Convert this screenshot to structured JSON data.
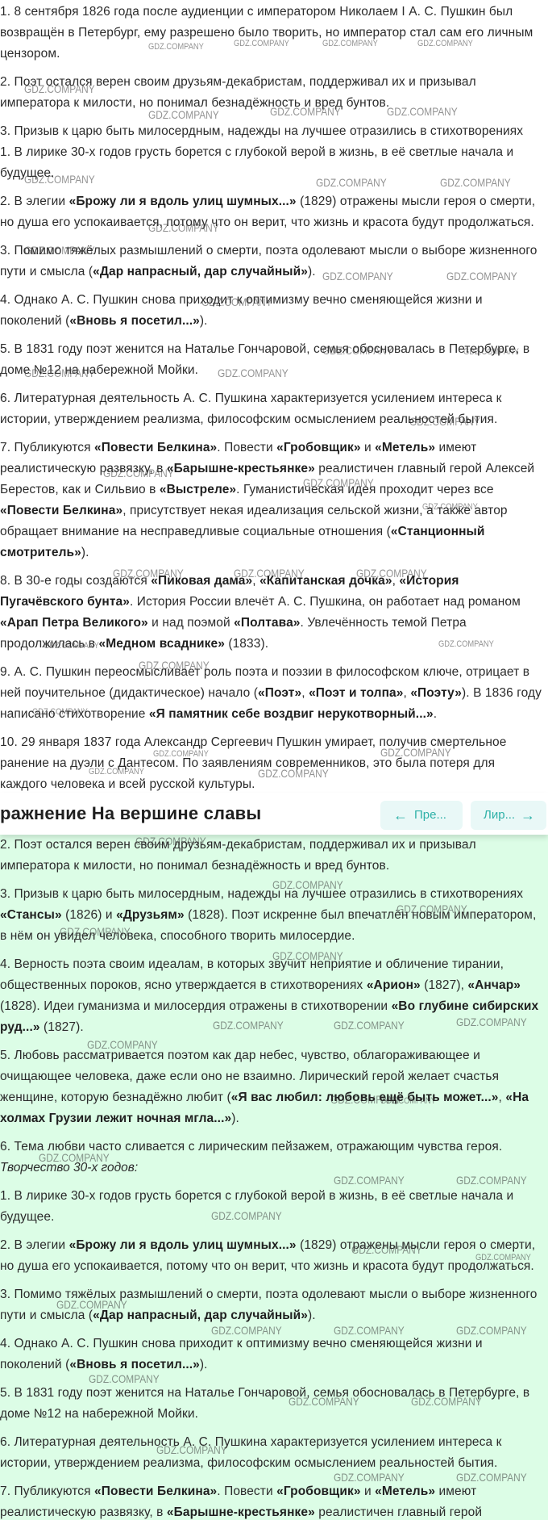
{
  "watermark": "GDZ.COMPANY",
  "header": {
    "title": "ражнение На вершине славы",
    "prev_label": "Пре...",
    "next_label": "Лир...",
    "prev_arrow": "←",
    "next_arrow": "→"
  },
  "colors": {
    "accent": "#2fb1a8",
    "button_bg": "#e9f8f7",
    "answer_bg": "#dcfde6"
  },
  "top_paragraphs": [
    "1. 8 сентября 1826 года после аудиенции с императором Николаем I А. С. Пушкин был возвращён в Петербург, ему разрешено было творить, но император стал сам его личным цензором.",
    "2. Поэт остался верен своим друзьям-декабристам, поддерживал их и призывал императора к милости, но понимал безнадёжность и вред бунтов.",
    "3. Призыв к царю быть милосердным, надежды на лучшее отразились в стихотворениях",
    "1. В лирике 30-х годов грусть борется с глубокой верой в жизнь, в её светлые начала и будущее.",
    "2. В элегии «Брожу ли я вдоль улиц шумных...» (1829) отражены мысли героя о смерти, но душа его успокаивается, потому что он верит, что жизнь и красота будут продолжаться.",
    "3. Помимо тяжёлых размышлений о смерти, поэта одолевают мысли о выборе жизненного пути и смысла («Дар напрасный, дар случайный»).",
    "4. Однако А. С. Пушкин снова приходит к оптимизму вечно сменяющейся жизни и поколений («Вновь я посетил...»).",
    "5. В 1831 году поэт женится на Наталье Гончаровой, семья обосновалась в Петербурге, в доме №12 на набережной Мойки.",
    "6. Литературная деятельность А. С. Пушкина характеризуется усилением интереса к истории, утверждением реализма, философским осмыслением реальностей бытия.",
    "7. Публикуются «Повести Белкина». Повести «Гробовщик» и «Метель» имеют реалистическую развязку, в «Барышне-крестьянке» реалистичен главный герой Алексей Берестов, как и Сильвио в «Выстреле». Гуманистическая идея проходит через все «Повести Белкина», присутствует некая идеализация сельской жизни, а также автор обращает внимание на несправедливые социальные отношения («Станционный смотритель»).",
    "8. В 30-е годы создаются «Пиковая дама», «Капитанская дочка», «История Пугачёвского бунта». История России влечёт А. С. Пушкина, он работает над романом «Арап Петра Великого» и над поэмой «Полтава». Увлечённость темой Петра продолжилась в «Медном всаднике» (1833).",
    "9. А. С. Пушкин переосмысливает роль поэта и поэзии в философском ключе, отрицает в ней поучительное (дидактическое) начало («Поэт», «Поэт и толпа», «Поэту»). В 1836 году написано стихотворение «Я памятник себе воздвиг нерукотворный...».",
    "10. 29 января 1837 года Александр Сергеевич Пушкин умирает, получив смертельное ранение на дуэли с Дантесом. По заявлениям современников, это была потеря для каждого человека и всей русской культуры."
  ],
  "bottom_paragraphs": [
    "2. Поэт остался верен своим друзьям-декабристам, поддерживал их и призывал императора к милости, но понимал безнадёжность и вред бунтов.",
    "3. Призыв к царю быть милосердным, надежды на лучшее отразились в стихотворениях «Стансы» (1826) и «Друзьям» (1828). Поэт искренне был впечатлён новым императором, в нём он увидел человека, способного творить милосердие.",
    "4. Верность поэта своим идеалам, в которых звучит неприятие и обличение тирании, общественных пороков, ясно утверждается в стихотворениях «Арион» (1827), «Анчар» (1828). Идеи гуманизма и милосердия отражены в стихотворении «Во глубине сибирских руд...» (1827).",
    "5. Любовь рассматривается поэтом как дар небес, чувство, облагораживающее и очищающее человека, даже если оно не взаимно. Лирический герой желает счастья женщине, которую безнадёжно любит («Я вас любил: любовь ещё быть может...», «На холмах Грузии лежит ночная мгла...»).",
    "6. Тема любви часто сливается с лирическим пейзажем, отражающим чувства героя.",
    "Творчество 30-х годов:",
    "1. В лирике 30-х годов грусть борется с глубокой верой в жизнь, в её светлые начала и будущее.",
    "2. В элегии «Брожу ли я вдоль улиц шумных...» (1829) отражены мысли героя о смерти, но душа его успокаивается, потому что он верит, что жизнь и красота будут продолжаться.",
    "3. Помимо тяжёлых размышлений о смерти, поэта одолевают мысли о выборе жизненного пути и смысла («Дар напрасный, дар случайный»).",
    "4. Однако А. С. Пушкин снова приходит к оптимизму вечно сменяющейся жизни и поколений («Вновь я посетил...»).",
    "5. В 1831 году поэт женится на Наталье Гончаровой, семья обосновалась в Петербурге, в доме №12 на набережной Мойки.",
    "6. Литературная деятельность А. С. Пушкина характеризуется усилением интереса к истории, утверждением реализма, философским осмыслением реальностей бытия.",
    "7. Публикуются «Повести Белкина». Повести «Гробовщик» и «Метель» имеют реалистическую развязку, в «Барышне-крестьянке» реалистичен главный герой"
  ]
}
